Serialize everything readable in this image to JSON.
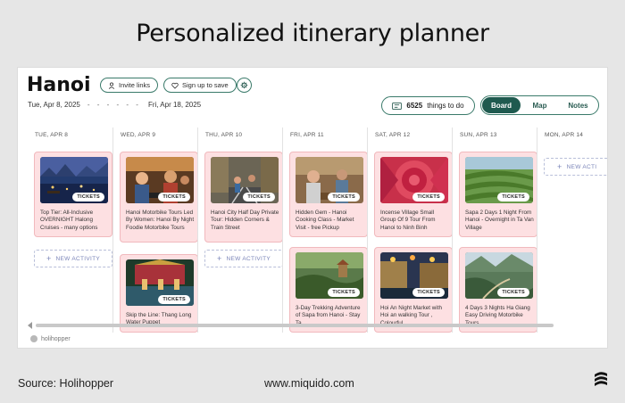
{
  "headline": "Personalized itinerary planner",
  "app": {
    "city": "Hanoi",
    "invite_label": "Invite links",
    "signup_label": "Sign up to save",
    "date_start": "Tue, Apr 8, 2025",
    "date_sep": "- - - - - -",
    "date_end": "Fri, Apr 18, 2025",
    "things_count": "6525",
    "things_label": "things to do",
    "views": [
      "Board",
      "Map",
      "Notes"
    ],
    "active_view": "Board",
    "new_activity_label": "NEW ACTIVITY",
    "new_activity_partial": "NEW ACTI",
    "tickets_label": "TICKETS",
    "columns": [
      {
        "date": "TUE, APR 8",
        "cards": [
          {
            "title": "Top Tier: All-Inclusive OVERNIGHT Halong Cruises - many options",
            "photo": "cruise-night"
          }
        ]
      },
      {
        "date": "WED, APR 9",
        "cards": [
          {
            "title": "Hanoi Motorbike Tours Led By Women: Hanoi By Night Foodie Motorbike Tours",
            "photo": "motorbike"
          },
          {
            "title": "Skip the Line: Thang Long Water Puppet",
            "photo": "puppet-stage"
          }
        ]
      },
      {
        "date": "THU, APR 10",
        "cards": [
          {
            "title": "Hanoi City Half Day Private Tour: Hidden Corners & Train Street",
            "photo": "train-street"
          }
        ]
      },
      {
        "date": "FRI, APR 11",
        "cards": [
          {
            "title": "Hidden Gem - Hanoi Cooking Class - Market Visit - free Pickup",
            "photo": "cooking"
          },
          {
            "title": "3-Day Trekking Adventure of Sapa from Hanoi - Stay Ta",
            "photo": "sapa-trek"
          }
        ]
      },
      {
        "date": "SAT, APR 12",
        "cards": [
          {
            "title": "Incense Village Small Group Of 9 Tour From Hanoi to Ninh Binh",
            "photo": "incense"
          },
          {
            "title": "Hoi An Night Market with Hoi an walking Tour , Colourful",
            "photo": "hoian"
          }
        ]
      },
      {
        "date": "SUN, APR 13",
        "cards": [
          {
            "title": "Sapa 2 Days 1 Night From Hanoi - Overnight in Ta Van Village",
            "photo": "rice-terraces"
          },
          {
            "title": "4 Days 3 Nights Ha Giang Easy Driving Motorbike Tours",
            "photo": "ha-giang"
          }
        ]
      },
      {
        "date": "MON, APR 14",
        "cards": []
      }
    ],
    "footer_brand": "holihopper"
  },
  "footer": {
    "source": "Source: Holihopper",
    "site": "www.miquido.com"
  }
}
